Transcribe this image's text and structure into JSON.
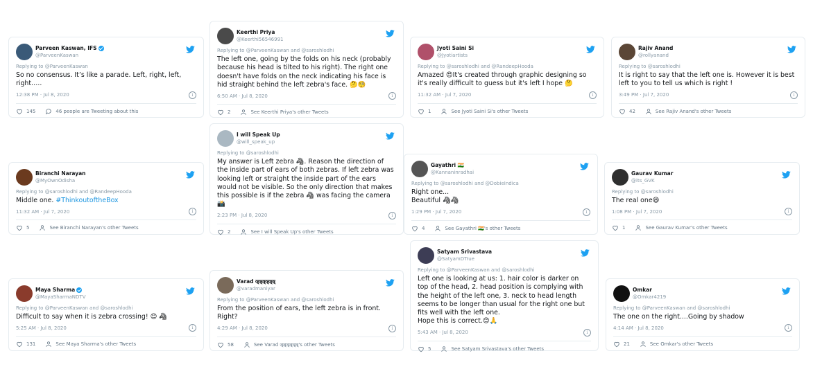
{
  "tweets": [
    {
      "name": "Parveen Kaswan, IFS",
      "verified": true,
      "handle": "@ParveenKaswan",
      "avatar_color": "#3a5a78",
      "reply": "Replying to @ParveenKaswan",
      "text": "So no consensus. It’s like a parade. Left, right, left, right…..",
      "tag": "",
      "time": "12:38 PM · Jul 8, 2020",
      "likes": "145",
      "other": "46 people are Tweeting about this",
      "other_icon": "bubble"
    },
    {
      "name": "Keerthi Priya",
      "verified": false,
      "handle": "@Keerthi56546991",
      "avatar_color": "#4a4a4a",
      "reply": "Replying to @ParveenKaswan and @saroshlodhi",
      "text": "The left one, going by the folds on his neck (probably because his head is tilted to his right). The right one doesn't have folds on the neck indicating his face is hid straight behind the left zebra's face. 🤔🧐",
      "tag": "",
      "time": "6:50 AM · Jul 8, 2020",
      "likes": "2",
      "other": "See Keerthi Priya's other Tweets",
      "other_icon": "person"
    },
    {
      "name": "Jyoti Saini Si",
      "verified": false,
      "handle": "@Jyotiartists",
      "avatar_color": "#b0506a",
      "reply": "Replying to @saroshlodhi and @RandeepHooda",
      "text": "Amazed 😍It's created through graphic designing so it's really difficult to guess but it's left I hope 🤔",
      "tag": "",
      "time": "11:32 AM · Jul 7, 2020",
      "likes": "1",
      "other": "See Jyoti Saini Si's other Tweets",
      "other_icon": "person"
    },
    {
      "name": "Rajiv Anand",
      "verified": false,
      "handle": "@rollyanand",
      "avatar_color": "#5b4636",
      "reply": "Replying to @saroshlodhi",
      "text": "It is right to say that the left one is. However it is best left to you to tell us which is right !",
      "tag": "",
      "time": "3:49 PM · Jul 7, 2020",
      "likes": "42",
      "other": "See Rajiv Anand's other Tweets",
      "other_icon": "person"
    },
    {
      "name": "I will Speak Up",
      "verified": false,
      "handle": "@will_speak_up",
      "avatar_color": "#aab8c2",
      "reply": "Replying to @saroshlodhi",
      "text": "My answer is Left zebra 🦓. Reason the direction of the inside part of ears of both zebras. If left zebra was looking left or straight the inside part of the ears would not be visible. So the only direction that makes this possible is if the zebra 🦓 was facing the camera 📸",
      "tag": "",
      "time": "2:23 PM · Jul 8, 2020",
      "likes": "2",
      "other": "See I will Speak Up's other Tweets",
      "other_icon": "person"
    },
    {
      "name": "Biranchi Narayan",
      "verified": false,
      "handle": "@MyOwnOdisha",
      "avatar_color": "#6b3a1e",
      "reply": "Replying to @saroshlodhi and @RandeepHooda",
      "text": "Middle one. ",
      "tag": "#ThinkoutoftheBox",
      "time": "11:32 AM · Jul 7, 2020",
      "likes": "5",
      "other": "See Biranchi Narayan's other Tweets",
      "other_icon": "person"
    },
    {
      "name": "Gayathri 🇮🇳",
      "verified": false,
      "handle": "@Kannaninradhai",
      "avatar_color": "#555555",
      "reply": "Replying to @saroshlodhi and @DobieIndica",
      "text": "Right one...\nBeautiful 🦓🦓",
      "tag": "",
      "time": "1:29 PM · Jul 7, 2020",
      "likes": "4",
      "other": "See Gayathri 🇮🇳's other Tweets",
      "other_icon": "person"
    },
    {
      "name": "Gaurav Kumar",
      "verified": false,
      "handle": "@its_GVK",
      "avatar_color": "#2f2f2f",
      "reply": "Replying to @saroshlodhi",
      "text": "The real one😆",
      "tag": "",
      "time": "1:08 PM · Jul 7, 2020",
      "likes": "1",
      "other": "See Gaurav Kumar's other Tweets",
      "other_icon": "person"
    },
    {
      "name": "Satyam Srivastava",
      "verified": false,
      "handle": "@SatyamDTrue",
      "avatar_color": "#3d3d55",
      "reply": "Replying to @ParveenKaswan and @saroshlodhi",
      "text": "Left one is looking at us: 1. hair color is darker on top of the head, 2. head position is complying with the height of the left one, 3. neck to head length seems to be longer than usual for the right one but fits well with the left one.\nHope this is correct.😊🙏",
      "tag": "",
      "time": "5:43 AM · Jul 8, 2020",
      "likes": "5",
      "other": "See Satyam Srivastava's other Tweets",
      "other_icon": "person"
    },
    {
      "name": "Maya Sharma",
      "verified": true,
      "handle": "@MayaSharmaNDTV",
      "avatar_color": "#8a3b2c",
      "reply": "Replying to @ParveenKaswan and @saroshlodhi",
      "text": "Difficult to say when it is zebra crossing! 😊 🦓",
      "tag": "",
      "time": "5:25 AM · Jul 8, 2020",
      "likes": "131",
      "other": "See Maya Sharma's other Tweets",
      "other_icon": "person"
    },
    {
      "name": "Varad 𑐀𑐀𑐀𑐀𑐀𑐀",
      "verified": false,
      "handle": "@varadmaniyar",
      "avatar_color": "#7a6a5a",
      "reply": "Replying to @ParveenKaswan and @saroshlodhi",
      "text": "From the position of ears, the left zebra is in front. Right?",
      "tag": "",
      "time": "4:29 AM · Jul 8, 2020",
      "likes": "58",
      "other": "See Varad 𑐀𑐀𑐀𑐀𑐀𑐀's other Tweets",
      "other_icon": "person"
    },
    {
      "name": "Omkar",
      "verified": false,
      "handle": "@Omkar4219",
      "avatar_color": "#111111",
      "reply": "Replying to @ParveenKaswan and @saroshlodhi",
      "text": "The one on the right....Going by shadow",
      "tag": "",
      "time": "4:14 AM · Jul 8, 2020",
      "likes": "21",
      "other": "See Omkar's other Tweets",
      "other_icon": "person"
    }
  ]
}
